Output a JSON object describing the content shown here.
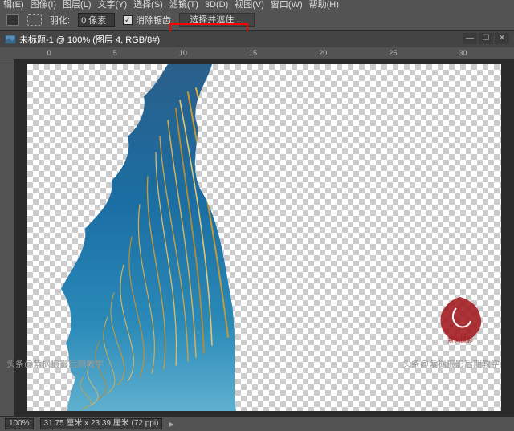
{
  "menubar": {
    "items": [
      "辑(E)",
      "图像(I)",
      "图层(L)",
      "文字(Y)",
      "选择(S)",
      "滤镜(T)",
      "3D(D)",
      "视图(V)",
      "窗口(W)",
      "帮助(H)"
    ]
  },
  "toolbar": {
    "feather_label": "羽化:",
    "feather_value": "0 像素",
    "antialias_label": "消除锯齿",
    "select_mask_label": "选择并遮住 ..."
  },
  "tab": {
    "title": "未标题-1 @ 100% (图层 4, RGB/8#)"
  },
  "ruler_h": [
    "0",
    "5",
    "10",
    "15",
    "20",
    "25",
    "30"
  ],
  "statusbar": {
    "zoom": "100%",
    "dims": "31.75 厘米 x 23.39 厘米 (72 ppi)"
  },
  "watermarks": {
    "bl": "头条@紫枫摄影后期教学",
    "br": "头条@紫枫摄影后期教学",
    "stamp_sub": "紫枫摄影"
  }
}
